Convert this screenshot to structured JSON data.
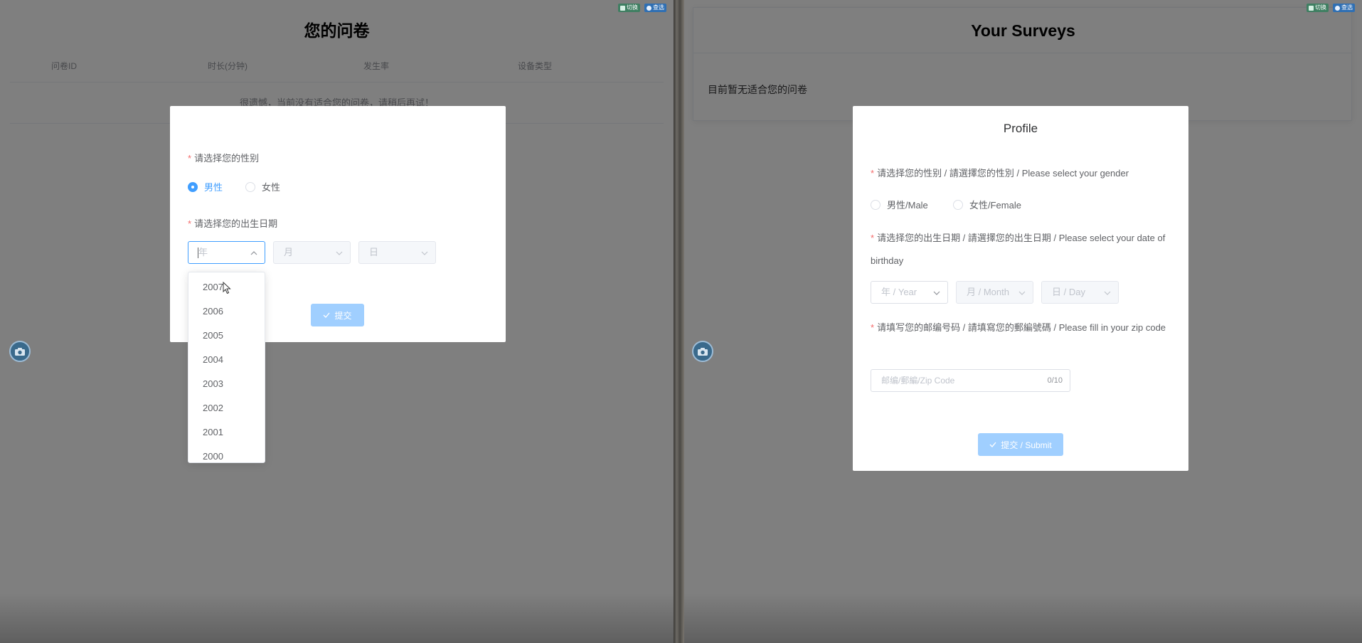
{
  "left": {
    "badges": {
      "switch": "切换",
      "choose": "查选"
    },
    "page_title": "您的问卷",
    "columns": [
      "问卷ID",
      "时长(分钟)",
      "发生率",
      "设备类型"
    ],
    "empty_message": "很遗憾，当前没有适合您的问卷，请稍后再试！",
    "dialog": {
      "gender_label": "请选择您的性别",
      "gender_options": [
        {
          "label": "男性",
          "checked": true
        },
        {
          "label": "女性",
          "checked": false
        }
      ],
      "birthday_label": "请选择您的出生日期",
      "year_placeholder": "年",
      "month_placeholder": "月",
      "day_placeholder": "日",
      "submit_label": "提交"
    },
    "year_dropdown": [
      "2007",
      "2006",
      "2005",
      "2004",
      "2003",
      "2002",
      "2001",
      "2000"
    ]
  },
  "right": {
    "badges": {
      "switch": "切换",
      "choose": "查选"
    },
    "page_title": "Your Surveys",
    "empty_message": "目前暂无适合您的问卷",
    "dialog": {
      "title": "Profile",
      "gender_label": "请选择您的性别 / 請選擇您的性別 / Please select your gender",
      "gender_options": [
        {
          "label": "男性/Male",
          "checked": false
        },
        {
          "label": "女性/Female",
          "checked": false
        }
      ],
      "birthday_label": "请选择您的出生日期 / 請選擇您的出生日期 / Please select your date of birthday",
      "year_placeholder": "年 / Year",
      "month_placeholder": "月 / Month",
      "day_placeholder": "日 / Day",
      "zip_label": "请填写您的邮编号码 / 請填寫您的郵編號碼 / Please fill in your zip code",
      "zip_placeholder": "邮编/郵編/Zip Code",
      "zip_counter": "0/10",
      "submit_label": "提交 / Submit"
    }
  },
  "colors": {
    "primary": "#409eff",
    "primary_disabled": "#a0cfff",
    "required": "#f56c6c"
  }
}
